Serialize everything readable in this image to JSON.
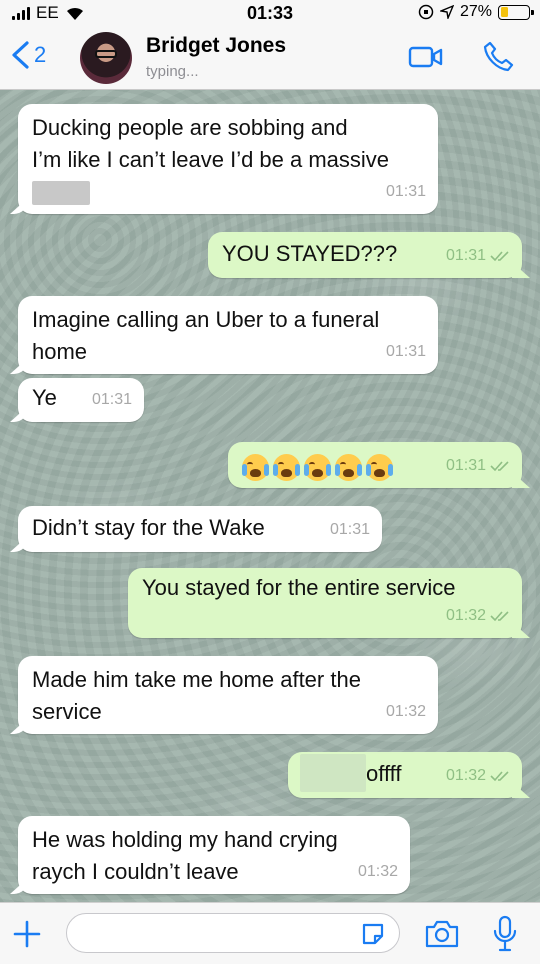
{
  "status_bar": {
    "carrier": "EE",
    "time": "01:33",
    "battery": "27%",
    "battery_level": 0.27
  },
  "header": {
    "back_count": "2",
    "contact_name": "Bridget Jones",
    "status": "typing..."
  },
  "messages": [
    {
      "dir": "in",
      "lines": [
        "Ducking people are sobbing and",
        "I’m like I can’t leave I’d be a massive"
      ],
      "time": "01:31"
    },
    {
      "dir": "out",
      "text": "YOU STAYED???",
      "time": "01:31"
    },
    {
      "dir": "in",
      "lines": [
        "Imagine calling an Uber to a funeral",
        "home"
      ],
      "time": "01:31"
    },
    {
      "dir": "in",
      "text": "Ye",
      "time": "01:31"
    },
    {
      "dir": "out",
      "emoji_count": 5,
      "emoji": "loudly-crying-face",
      "time": "01:31"
    },
    {
      "dir": "in",
      "text": "Didn’t stay for the Wake",
      "time": "01:31"
    },
    {
      "dir": "out",
      "text": "You stayed for the entire service",
      "time": "01:32"
    },
    {
      "dir": "in",
      "lines": [
        "Made him take me home after the",
        "service"
      ],
      "time": "01:32"
    },
    {
      "dir": "out",
      "text": "offff",
      "time": "01:32"
    },
    {
      "dir": "in",
      "lines": [
        "He was holding my hand crying",
        "raych I couldn’t leave"
      ],
      "time": "01:32"
    }
  ],
  "input": {
    "value": "",
    "placeholder": ""
  },
  "colors": {
    "accent": "#1a7cf2",
    "outgoing_bubble": "#dcf8c6",
    "incoming_bubble": "#ffffff",
    "read_tick": "#8fbf84"
  }
}
